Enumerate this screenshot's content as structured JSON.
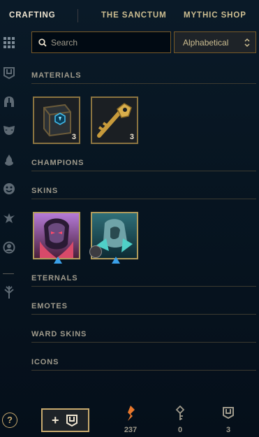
{
  "nav": {
    "tabs": [
      {
        "label": "CRAFTING",
        "active": true
      },
      {
        "label": "THE SANCTUM",
        "active": false
      },
      {
        "label": "MYTHIC SHOP",
        "active": false
      }
    ]
  },
  "rail": {
    "icons": [
      "all-loot-icon",
      "chest-icon",
      "champion-helmet-icon",
      "skin-mask-icon",
      "ward-flame-icon",
      "emote-face-icon",
      "eternals-icon",
      "summoner-icon-icon",
      "loot-tree-icon"
    ]
  },
  "search": {
    "placeholder": "Search",
    "value": ""
  },
  "sort": {
    "selected": "Alphabetical"
  },
  "sections": {
    "materials": "MATERIALS",
    "champions": "CHAMPIONS",
    "skins": "SKINS",
    "eternals": "ETERNALS",
    "emotes": "EMOTES",
    "wards": "WARD SKINS",
    "icons": "ICONS"
  },
  "materials": [
    {
      "name": "hextech-chest",
      "count": "3"
    },
    {
      "name": "hextech-key",
      "count": "3"
    }
  ],
  "skins": [
    {
      "name": "skin-shard-1",
      "owned_badge": false
    },
    {
      "name": "skin-shard-2",
      "owned_badge": true
    }
  ],
  "bottom": {
    "help_label": "?",
    "add_label": "+",
    "currencies": [
      {
        "name": "orange-essence",
        "value": "237",
        "color": "#e8782c"
      },
      {
        "name": "key-fragments",
        "value": "0",
        "color": "#a09b8c"
      },
      {
        "name": "chests",
        "value": "3",
        "color": "#a09b8c"
      }
    ]
  },
  "colors": {
    "gold": "#c8aa6e",
    "gold_dark": "#785a28",
    "text": "#a09b8c",
    "bg": "#010a13",
    "accent_blue": "#0ac8b9"
  }
}
